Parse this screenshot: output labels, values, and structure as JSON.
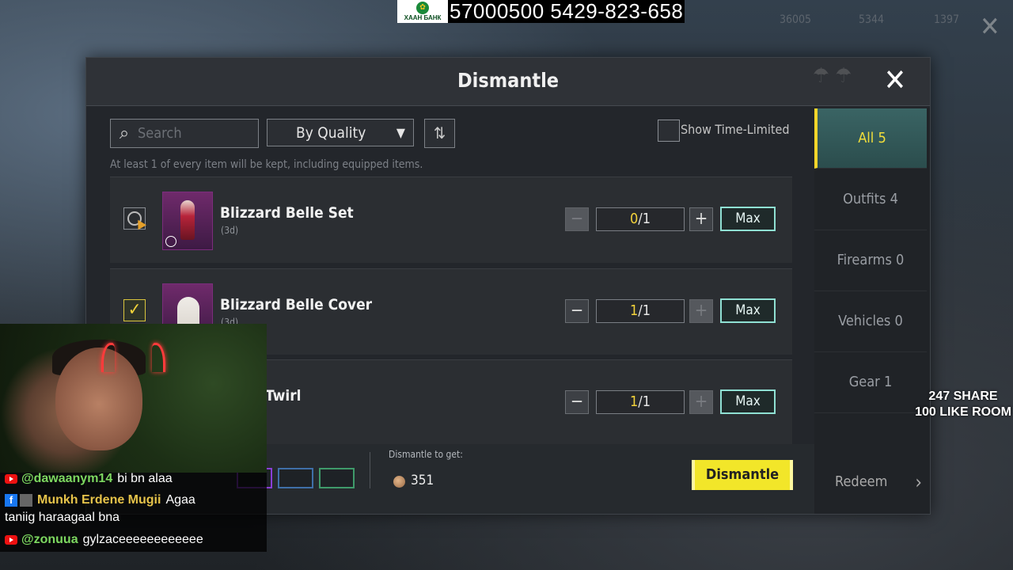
{
  "banner": {
    "bank_name": "ХААН БАНК",
    "text": "57000500 5429-823-658"
  },
  "hud": {
    "stat1": "36005",
    "stat2": "5344",
    "stat3": "1397"
  },
  "modal": {
    "title": "Dismantle",
    "search_placeholder": "Search",
    "sort_label": "By Quality",
    "time_limited_label": "Show Time-Limited Items",
    "hint": "At least 1 of every item will be kept, including equipped items.",
    "items": [
      {
        "name": "Blizzard Belle Set",
        "duration": "(3d)",
        "checked": false,
        "qty_current": "0",
        "qty_sep": "/",
        "qty_total": "1",
        "max_label": "Max"
      },
      {
        "name": "Blizzard Belle Cover",
        "duration": "(3d)",
        "checked": true,
        "qty_current": "1",
        "qty_sep": "/",
        "qty_total": "1",
        "max_label": "Max"
      },
      {
        "name": "Twirl",
        "duration": "",
        "checked": true,
        "qty_current": "1",
        "qty_sep": "/",
        "qty_total": "1",
        "max_label": "Max"
      }
    ],
    "get_label": "Dismantle to get:",
    "get_value": "351",
    "dismantle_label": "Dismantle"
  },
  "sidebar": {
    "tabs": [
      {
        "label": "All 5",
        "active": true
      },
      {
        "label": "Outfits 4",
        "active": false
      },
      {
        "label": "Firearms 0",
        "active": false
      },
      {
        "label": "Vehicles 0",
        "active": false
      },
      {
        "label": "Gear 1",
        "active": false
      }
    ],
    "redeem": "Redeem"
  },
  "rarity_colors": [
    "#8a3fd6",
    "#3f6fa8",
    "#3f9a6a"
  ],
  "chat": [
    {
      "platform": "youtube",
      "user": "@dawaanym14",
      "user_color": "#7dd860",
      "msg": "bi bn alaa"
    },
    {
      "platform": "facebook",
      "user": "Munkh Erdene Mugii",
      "user_color": "#e6c34a",
      "msg": "Agaa"
    },
    {
      "platform": "none",
      "user": "",
      "user_color": "#ffffff",
      "msg": "taniig haraagaal bna"
    },
    {
      "platform": "youtube",
      "user": "@zonuua",
      "user_color": "#7dd860",
      "msg": "gylzaceeeeeeeeeeee"
    }
  ],
  "overlay": {
    "share": "247 SHARE",
    "like": "100 LIKE ROOM"
  }
}
